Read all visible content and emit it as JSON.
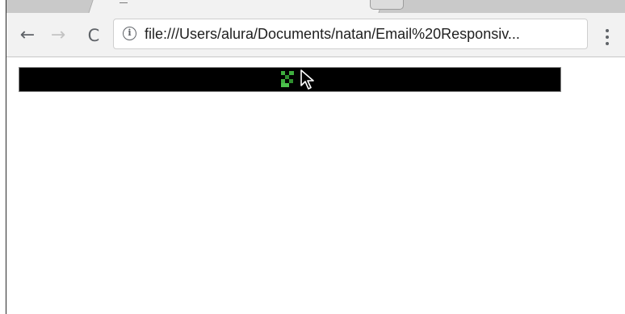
{
  "browser": {
    "nav": {
      "back_glyph": "←",
      "forward_glyph": "→",
      "reload_glyph": "C"
    },
    "omnibox": {
      "info_glyph": "i",
      "url": "file:///Users/alura/Documents/natan/Email%20Responsiv..."
    },
    "icons": [
      "back-arrow-icon",
      "forward-arrow-icon",
      "reload-icon",
      "info-icon",
      "menu-kebab-icon"
    ]
  },
  "page": {
    "banner": {
      "background": "#000000",
      "image_state": "broken-image",
      "image_icon": "broken-image-icon",
      "image_accent": "#3fae3f"
    },
    "cursor_icon": "mouse-pointer-icon"
  }
}
